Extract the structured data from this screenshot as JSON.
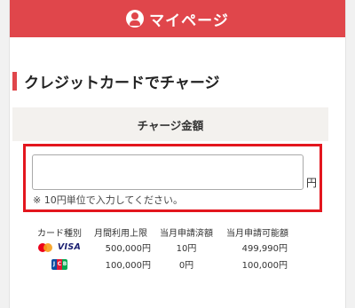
{
  "header": {
    "title": "マイページ"
  },
  "section": {
    "title": "クレジットカードでチャージ"
  },
  "charge": {
    "heading": "チャージ金額",
    "input_value": "",
    "unit": "円",
    "note": "※ 10円単位で入力してください。"
  },
  "table": {
    "headers": [
      "カード種別",
      "月間利用上限",
      "当月申請済額",
      "当月申請可能額"
    ],
    "rows": [
      {
        "brands": [
          "mastercard",
          "visa"
        ],
        "brand_text": "VISA",
        "limit": "500,000円",
        "used": "10円",
        "available": "499,990円"
      },
      {
        "brands": [
          "jcb"
        ],
        "brand_text": "JCB",
        "limit": "100,000円",
        "used": "0円",
        "available": "100,000円"
      }
    ]
  },
  "colors": {
    "accent": "#e0464b",
    "highlight": "#e3161e"
  }
}
